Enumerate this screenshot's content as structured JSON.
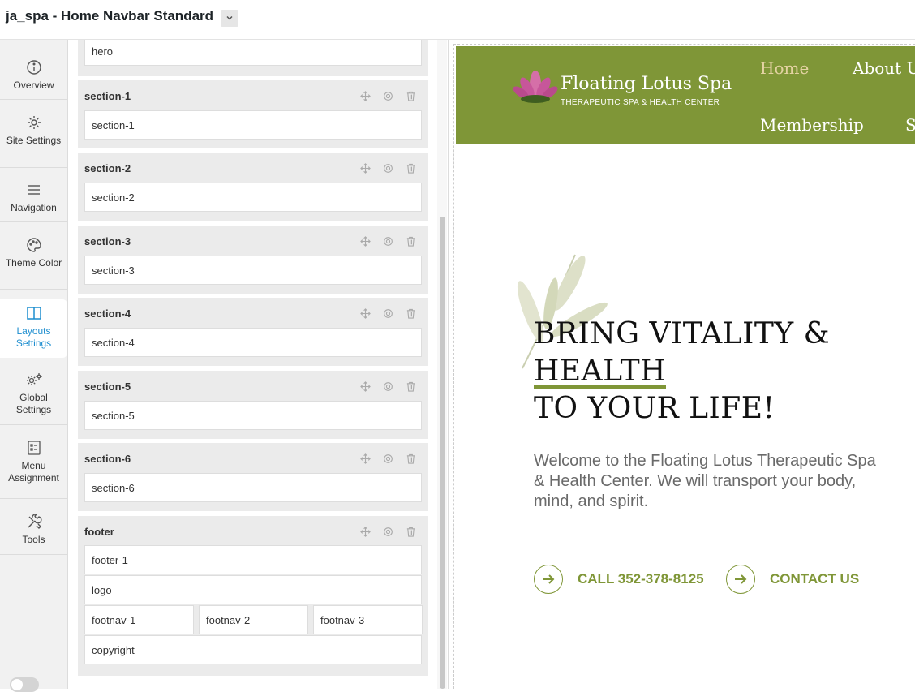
{
  "app": {
    "title": "ja_spa - Home Navbar Standard"
  },
  "sidebar": {
    "items": [
      {
        "label": "Overview",
        "icon": "info-icon"
      },
      {
        "label": "Site Settings",
        "icon": "gear-icon"
      },
      {
        "label": "Navigation",
        "icon": "menu-icon"
      },
      {
        "label": "Theme Color",
        "icon": "palette-icon"
      },
      {
        "label": "Layouts Settings",
        "icon": "layout-icon",
        "active": true
      },
      {
        "label": "Global Settings",
        "icon": "gears-icon"
      },
      {
        "label": "Menu Assignment",
        "icon": "checklist-icon"
      },
      {
        "label": "Tools",
        "icon": "tools-icon"
      }
    ],
    "active_color": "#1c8dcf"
  },
  "layout": {
    "hero_position": "hero",
    "blocks": [
      {
        "name": "section-1",
        "positions": [
          "section-1"
        ]
      },
      {
        "name": "section-2",
        "positions": [
          "section-2"
        ]
      },
      {
        "name": "section-3",
        "positions": [
          "section-3"
        ]
      },
      {
        "name": "section-4",
        "positions": [
          "section-4"
        ]
      },
      {
        "name": "section-5",
        "positions": [
          "section-5"
        ]
      },
      {
        "name": "section-6",
        "positions": [
          "section-6"
        ]
      },
      {
        "name": "footer",
        "positions": [
          "footer-1",
          "logo",
          "footnav-1",
          "footnav-2",
          "footnav-3",
          "copyright"
        ]
      }
    ]
  },
  "preview": {
    "brand_color": "#7f9637",
    "logo": {
      "name": "Floating Lotus Spa",
      "tagline": "THERAPEUTIC SPA & HEALTH CENTER"
    },
    "nav": [
      "Home",
      "About U",
      "Membership",
      "S"
    ],
    "hero": {
      "line1": "BRING VITALITY &",
      "line2": "HEALTH",
      "line3": "TO YOUR LIFE!",
      "text": "Welcome to the Floating Lotus Therapeutic Spa & Health Center. We will transport your body, mind, and spirit.",
      "cta_call": "CALL 352-378-8125",
      "cta_contact": "CONTACT US"
    }
  }
}
